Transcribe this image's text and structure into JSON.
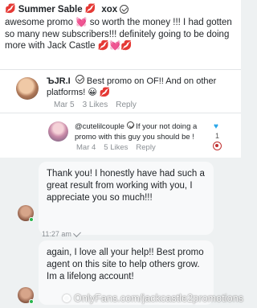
{
  "review": {
    "name": "Summer Sable",
    "tag": "xox",
    "body": "awesome promo 💓 so worth the money !!! I had gotten so many new subscribers!!! definitely going to be doing more with Jack Castle 💋💓💋",
    "icons": [
      "lips-icon",
      "lips-icon",
      "verified-icon"
    ]
  },
  "reply1": {
    "name": "ЪJR.I",
    "text": "Best promo on OF!! And on other platforms! 😀 💋",
    "date": "Mar 5",
    "likes": "3 Likes",
    "reply_label": "Reply"
  },
  "reply2": {
    "name": "@cutelilcouple",
    "text": "If your not doing a promo with this guy you should be !",
    "date": "Mar 4",
    "likes": "5 Likes",
    "reply_label": "Reply",
    "like_count": "1"
  },
  "chat": {
    "message1": "Thank you! I honestly have had such a great result from working with you, I appreciate you so much!!!",
    "time1": "11:27 am",
    "message2": "again, I love all your help!! Best promo agent on this site to help others grow. Im a lifelong account!"
  },
  "watermark": "OnlyFans.com/jackcastle2promotions",
  "colors": {
    "lips": "#d62c3a",
    "heart": "#f06aa8",
    "like": "#2aa6e8",
    "online": "#27b44b"
  }
}
